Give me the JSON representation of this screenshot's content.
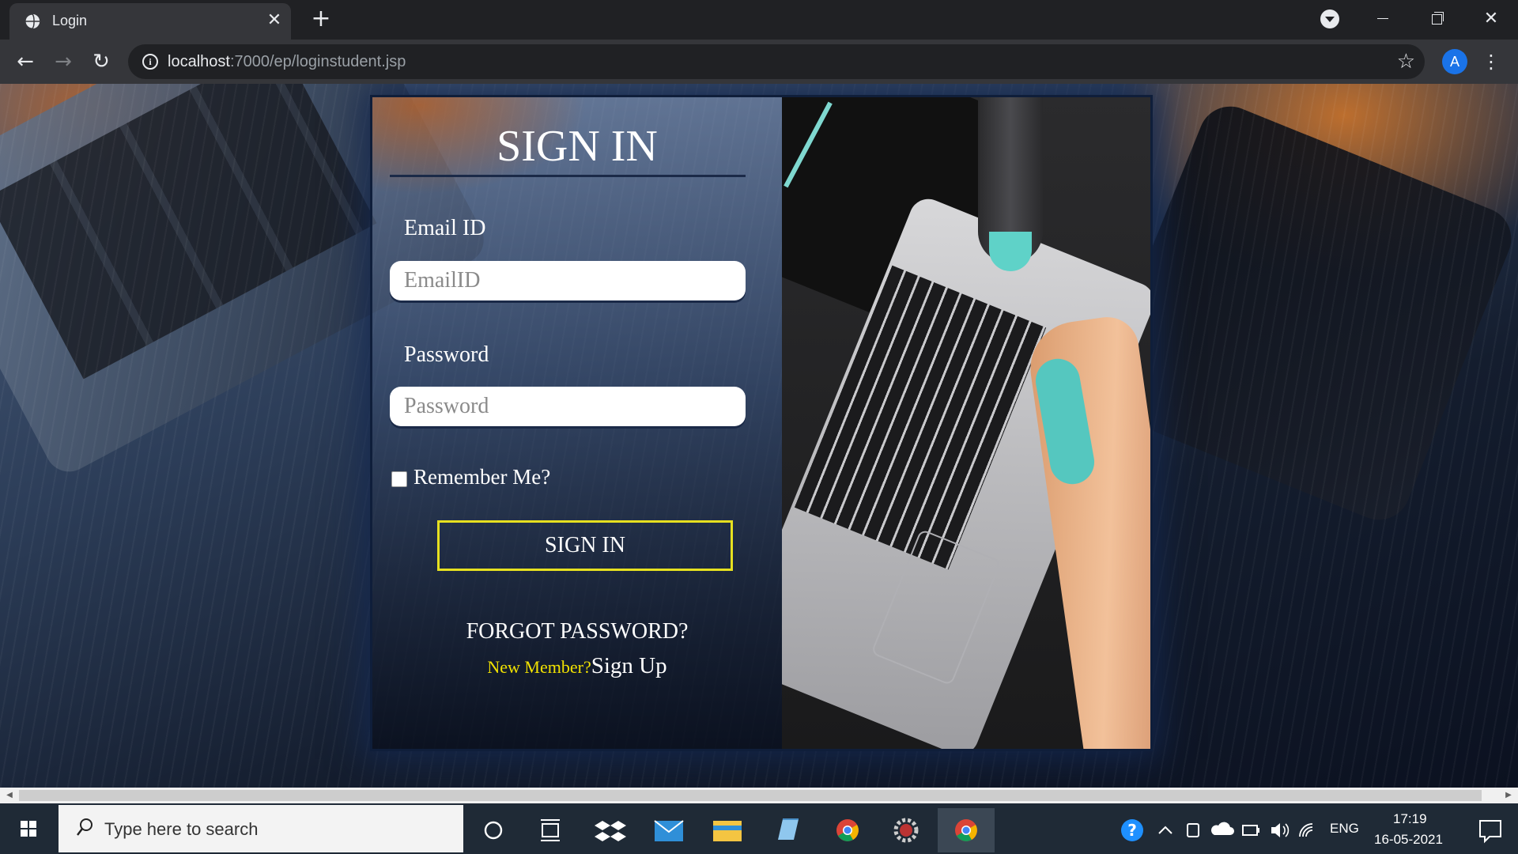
{
  "browser": {
    "tab_title": "Login",
    "tab_close": "✕",
    "new_tab": "+",
    "url_host": "localhost",
    "url_path": ":7000/ep/loginstudent.jsp",
    "profile_initial": "A",
    "menu": "⋮",
    "back": "←",
    "forward": "→",
    "reload": "↻",
    "star": "☆",
    "win_close": "✕"
  },
  "form": {
    "title": "SIGN IN",
    "email_label": "Email ID",
    "email_placeholder": "EmailID",
    "password_label": "Password",
    "password_placeholder": "Password",
    "remember_label": "Remember Me?",
    "remember_checked": false,
    "signin_button": "SIGN IN",
    "forgot_link": "FORGOT PASSWORD?",
    "new_member_text": "New Member?",
    "signup_link": "Sign Up"
  },
  "taskbar": {
    "search_placeholder": "Type here to search",
    "language": "ENG",
    "time": "17:19",
    "date": "16-05-2021"
  },
  "colors": {
    "button_border": "#e6e020",
    "new_member_text": "#f2e200",
    "profile_avatar": "#1a73e8"
  }
}
